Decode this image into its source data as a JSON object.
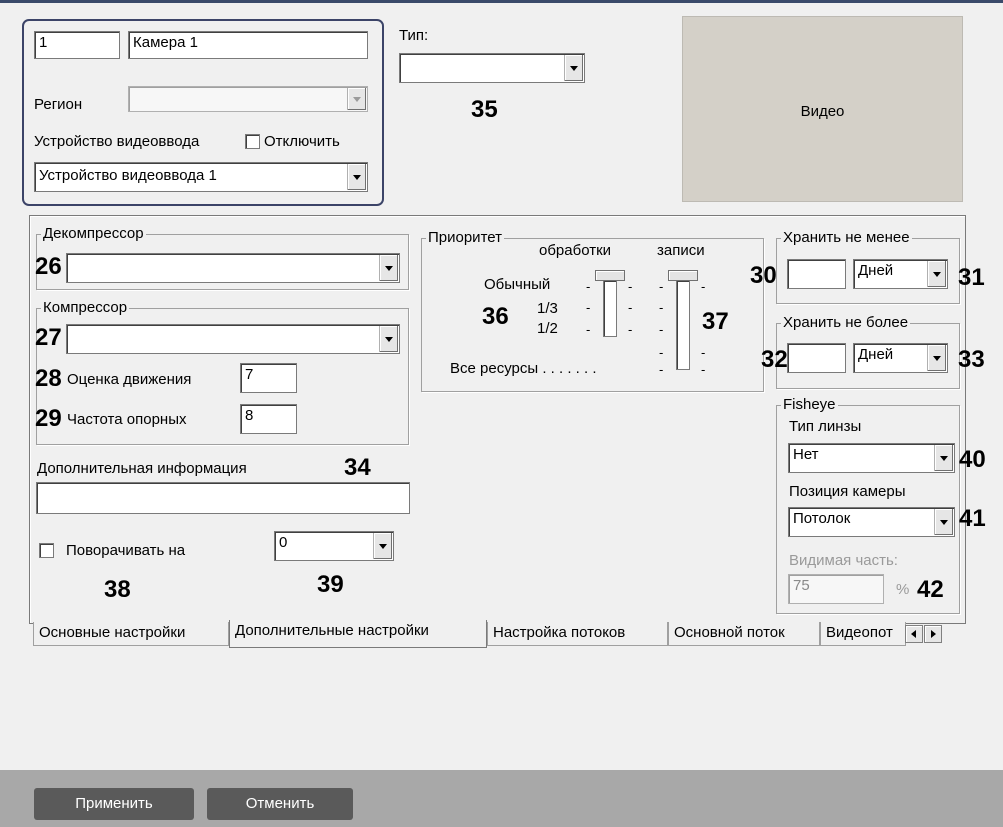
{
  "camera": {
    "id": "1",
    "name": "Камера 1"
  },
  "region": {
    "label": "Регион",
    "value": ""
  },
  "video_input": {
    "label": "Устройство видеоввода",
    "disable_label": "Отключить",
    "value": "Устройство видеоввода 1"
  },
  "type": {
    "label": "Тип:",
    "value": ""
  },
  "video_label": "Видео",
  "decompressor": {
    "label": "Декомпрессор",
    "value": ""
  },
  "compressor": {
    "label": "Компрессор",
    "value": "",
    "motion_label": "Оценка движения",
    "motion_value": "7",
    "keyframe_label": "Частота опорных",
    "keyframe_value": "8"
  },
  "extra_info": {
    "label": "Дополнительная информация",
    "value": ""
  },
  "rotate": {
    "label": "Поворачивать на",
    "value": "0"
  },
  "priority": {
    "label": "Приоритет",
    "processing": "обработки",
    "recording": "записи",
    "normal": "Обычный",
    "third": "1/3",
    "half": "1/2",
    "all": "Все ресурсы . . . . . . ."
  },
  "store_min": {
    "label": "Хранить не менее",
    "value": "",
    "unit": "Дней"
  },
  "store_max": {
    "label": "Хранить не более",
    "value": "",
    "unit": "Дней"
  },
  "fisheye": {
    "label": "Fisheye",
    "lens_label": "Тип линзы",
    "lens_value": "Нет",
    "position_label": "Позиция камеры",
    "position_value": "Потолок",
    "visible_label": "Видимая часть:",
    "visible_value": "75",
    "percent": "%"
  },
  "callouts": {
    "n26": "26",
    "n27": "27",
    "n28": "28",
    "n29": "29",
    "n30": "30",
    "n31": "31",
    "n32": "32",
    "n33": "33",
    "n34": "34",
    "n35": "35",
    "n36": "36",
    "n37": "37",
    "n38": "38",
    "n39": "39",
    "n40": "40",
    "n41": "41",
    "n42": "42"
  },
  "tabs": [
    {
      "label": "Основные настройки"
    },
    {
      "label": "Дополнительные настройки"
    },
    {
      "label": "Настройка потоков"
    },
    {
      "label": "Основной поток"
    },
    {
      "label": "Видеопот"
    }
  ],
  "buttons": {
    "apply": "Применить",
    "cancel": "Отменить"
  }
}
